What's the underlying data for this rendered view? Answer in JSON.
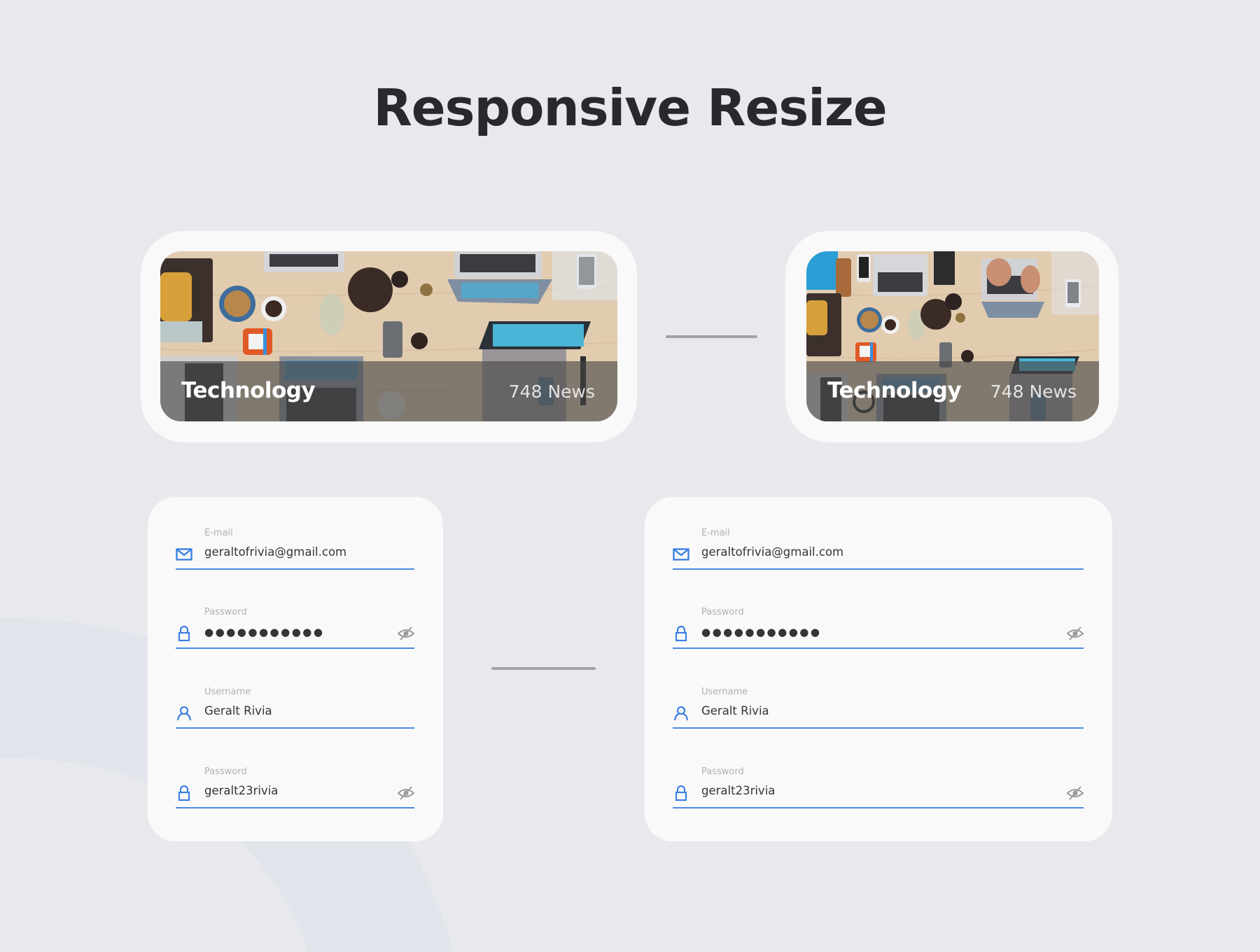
{
  "page": {
    "title": "Responsive Resize",
    "background_color": "#e8e9ed",
    "accent_color": "#3d80e3"
  },
  "category_cards": [
    {
      "variant": "wide",
      "title": "Technology",
      "count_label": "748 News",
      "image_alt": "Overhead view of a wooden desk with laptops, phones, a teapot and snacks"
    },
    {
      "variant": "narrow",
      "title": "Technology",
      "count_label": "748 News",
      "image_alt": "Overhead view of a wooden desk with laptops, phones, a teapot and snacks"
    }
  ],
  "forms": [
    {
      "variant": "narrow",
      "fields": [
        {
          "label": "E-mail",
          "value": "geraltofrivia@gmail.com",
          "icon": "mail-icon"
        },
        {
          "label": "Password",
          "value": "●●●●●●●●●●●",
          "icon": "lock-icon",
          "masked": true,
          "toggle_icon": "eye-off-icon"
        },
        {
          "label": "Username",
          "value": "Geralt Rivia",
          "icon": "user-icon"
        },
        {
          "label": "Password",
          "value": "geralt23rivia",
          "icon": "lock-icon",
          "masked": false,
          "toggle_icon": "eye-off-icon"
        }
      ]
    },
    {
      "variant": "wide",
      "fields": [
        {
          "label": "E-mail",
          "value": "geraltofrivia@gmail.com",
          "icon": "mail-icon"
        },
        {
          "label": "Password",
          "value": "●●●●●●●●●●●",
          "icon": "lock-icon",
          "masked": true,
          "toggle_icon": "eye-off-icon"
        },
        {
          "label": "Username",
          "value": "Geralt Rivia",
          "icon": "user-icon"
        },
        {
          "label": "Password",
          "value": "geralt23rivia",
          "icon": "lock-icon",
          "masked": false,
          "toggle_icon": "eye-off-icon"
        }
      ]
    }
  ]
}
